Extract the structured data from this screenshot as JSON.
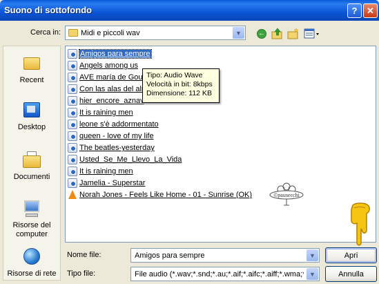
{
  "window": {
    "title": "Suono di sottofondo",
    "help_label": "?",
    "close_label": "✕"
  },
  "toolbar": {
    "look_in_label": "Cerca in:",
    "look_in_value": "Midi e piccoli wav",
    "back_icon": "back-icon",
    "up_icon": "up-folder-icon",
    "new_folder_icon": "new-folder-icon",
    "views_icon": "views-menu-icon"
  },
  "places": [
    {
      "label": "Recent",
      "icon": "recent-folder-icon"
    },
    {
      "label": "Desktop",
      "icon": "desktop-icon"
    },
    {
      "label": "Documenti",
      "icon": "documents-icon"
    },
    {
      "label": "Risorse del computer",
      "icon": "computer-icon"
    },
    {
      "label": "Risorse di rete",
      "icon": "network-icon"
    }
  ],
  "files": [
    {
      "name": "Amigos para sempre",
      "selected": true
    },
    {
      "name": "Angels among us"
    },
    {
      "name": "AVE maría de Gound"
    },
    {
      "name": "Con las alas del alm"
    },
    {
      "name": "hier_encore_aznav"
    },
    {
      "name": "It is raining men"
    },
    {
      "name": "leone s'è addormentato"
    },
    {
      "name": "queen - love of my life"
    },
    {
      "name": "The beatles-yesterday"
    },
    {
      "name": "Usted_Se_Me_Llevo_La_Vida"
    },
    {
      "name": "It is raining men"
    },
    {
      "name": "Jamelia - Superstar"
    },
    {
      "name": "Norah Jones - Feels Like Home - 01 - Sunrise (OK)",
      "icon": "vlc-cone-icon"
    }
  ],
  "tooltip": {
    "line1": "Tipo: Audio Wave",
    "line2": "Velocità in bit: 8kbps",
    "line3": "Dimensione: 112 KB"
  },
  "stamp_text": "©pausecchi",
  "form": {
    "filename_label": "Nome file:",
    "filename_value": "Amigos para sempre",
    "filetype_label": "Tipo file:",
    "filetype_value": "File audio (*.wav;*.snd;*.au;*.aif;*.aifc;*.aiff;*.wma;*.m",
    "open_label": "Apri",
    "cancel_label": "Annulla"
  },
  "colors": {
    "titlebar": "#0a5bd8",
    "selection": "#316ac5",
    "tooltip_bg": "#ffffe1"
  }
}
